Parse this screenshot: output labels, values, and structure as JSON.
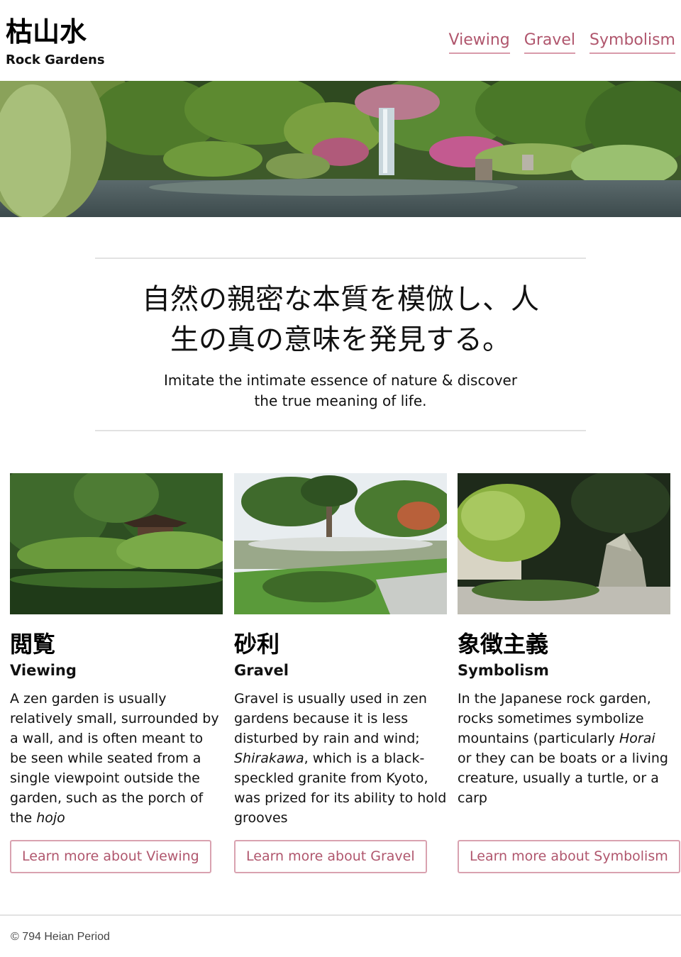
{
  "header": {
    "logo_jp": "枯山水",
    "logo_en": "Rock Gardens",
    "nav": [
      "Viewing",
      "Gravel",
      "Symbolism"
    ]
  },
  "intro": {
    "jp_line1": "自然の親密な本質を模倣し、人",
    "jp_line2": "生の真の意味を発見する。",
    "en_line1": "Imitate the intimate essence of nature & discover",
    "en_line2": "the true meaning of life."
  },
  "cards": [
    {
      "jp": "閲覧",
      "en": "Viewing",
      "body": "A zen garden is usually relatively small, surrounded by a wall, and is often meant to be seen while seated from a single viewpoint outside the garden, such as the porch of the ",
      "body_em": "hojo",
      "button": "Learn more about Viewing"
    },
    {
      "jp": "砂利",
      "en": "Gravel",
      "body_pre": "Gravel is usually used in zen gardens because it is less disturbed by rain and wind; ",
      "body_em": "Shirakawa",
      "body_post": ", which is a black-speckled granite from Kyoto, was prized for its ability to hold grooves",
      "button": "Learn more about Gravel"
    },
    {
      "jp": "象徴主義",
      "en": "Symbolism",
      "body_pre": "In the Japanese rock garden, rocks sometimes symbolize mountains (particularly ",
      "body_em": "Horai",
      "body_post": " or they can be boats or a living creature, usually a turtle, or a carp",
      "button": "Learn more about Symbolism"
    }
  ],
  "footer": {
    "text": "© 794 Heian Period"
  },
  "colors": {
    "accent": "#b0566d",
    "accent_border": "#d9a2b0",
    "rule": "#e2e2e2"
  }
}
